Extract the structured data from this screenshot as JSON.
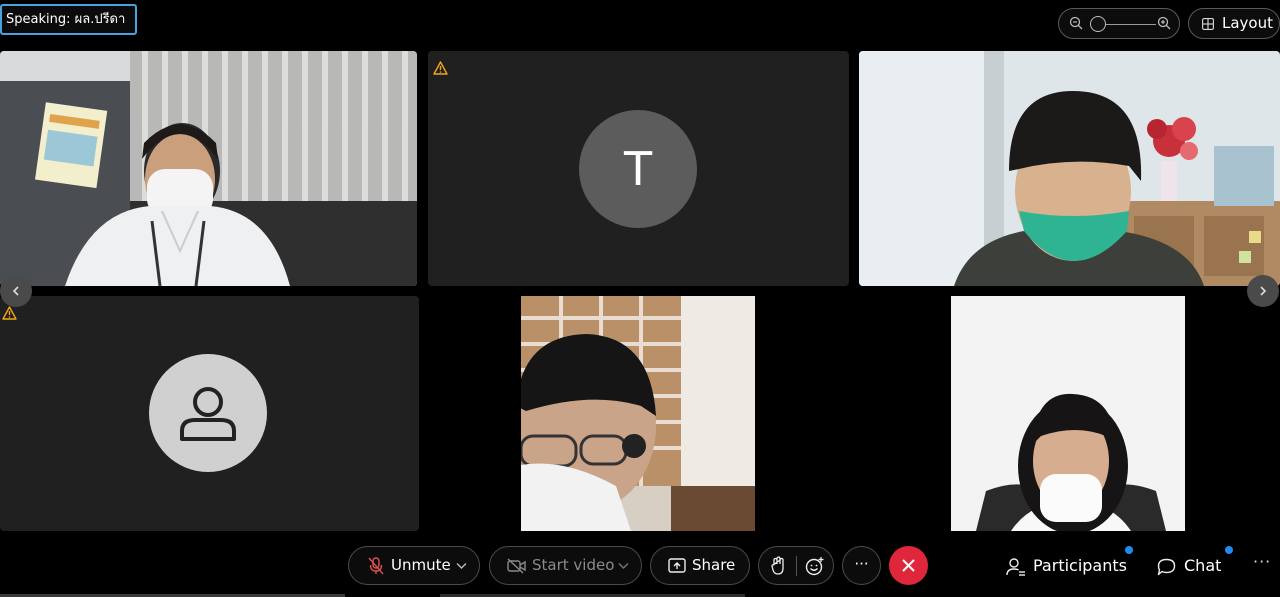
{
  "header": {
    "speaking_label": "Speaking: ผล.ปรีดา",
    "layout_label": "Layout"
  },
  "tiles": [
    {
      "id": "tile-1",
      "kind": "video",
      "description": "participant video"
    },
    {
      "id": "tile-2",
      "kind": "initial-avatar",
      "initial": "T",
      "warning": true
    },
    {
      "id": "tile-3",
      "kind": "video"
    },
    {
      "id": "tile-4",
      "kind": "person-avatar",
      "warning": true
    },
    {
      "id": "tile-5",
      "kind": "video"
    },
    {
      "id": "tile-6",
      "kind": "video"
    }
  ],
  "controls": {
    "unmute_label": "Unmute",
    "start_video_label": "Start video",
    "share_label": "Share",
    "more_label": "···",
    "participants_label": "Participants",
    "chat_label": "Chat",
    "overflow_label": "···"
  },
  "colors": {
    "speaking_border": "#4aa3df",
    "end_call": "#e0263a",
    "notification_dot": "#1f8bf0",
    "warning": "#f2a51a",
    "muted_icon": "#e05050"
  },
  "icons": [
    "zoom-out-icon",
    "zoom-in-icon",
    "layout-grid-icon",
    "warning-icon",
    "person-icon",
    "mic-off-icon",
    "chevron-down-icon",
    "video-off-icon",
    "share-screen-icon",
    "raise-hand-icon",
    "reaction-icon",
    "more-icon",
    "end-call-icon",
    "participants-icon",
    "chat-icon",
    "chevron-left-icon",
    "chevron-right-icon"
  ]
}
